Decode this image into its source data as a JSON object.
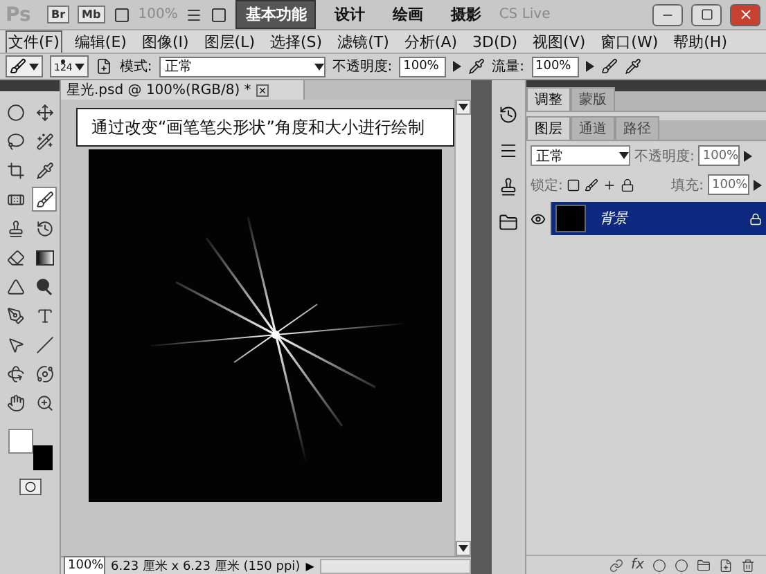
{
  "app_bar": {
    "logo": "Ps",
    "bridge": "Br",
    "mini_bridge": "Mb",
    "zoom": "100%",
    "workspaces": [
      {
        "label": "基本功能",
        "selected": true
      },
      {
        "label": "设计",
        "selected": false
      },
      {
        "label": "绘画",
        "selected": false
      },
      {
        "label": "摄影",
        "selected": false
      }
    ],
    "cs_live": "CS Live"
  },
  "menu": [
    {
      "label": "文件(F)",
      "selected": true
    },
    {
      "label": "编辑(E)",
      "selected": false
    },
    {
      "label": "图像(I)",
      "selected": false
    },
    {
      "label": "图层(L)",
      "selected": false
    },
    {
      "label": "选择(S)",
      "selected": false
    },
    {
      "label": "滤镜(T)",
      "selected": false
    },
    {
      "label": "分析(A)",
      "selected": false
    },
    {
      "label": "3D(D)",
      "selected": false
    },
    {
      "label": "视图(V)",
      "selected": false
    },
    {
      "label": "窗口(W)",
      "selected": false
    },
    {
      "label": "帮助(H)",
      "selected": false
    }
  ],
  "options": {
    "brush_size": "124",
    "mode_label": "模式:",
    "mode": "正常",
    "opacity_label": "不透明度:",
    "opacity": "100%",
    "flow_label": "流量:",
    "flow": "100%"
  },
  "tools": [
    {
      "kind": "marquee",
      "selected": false
    },
    {
      "kind": "move",
      "selected": false
    },
    {
      "kind": "lasso",
      "selected": false
    },
    {
      "kind": "wand",
      "selected": false
    },
    {
      "kind": "crop",
      "selected": false
    },
    {
      "kind": "eyedropper",
      "selected": false
    },
    {
      "kind": "heal",
      "selected": false
    },
    {
      "kind": "brush",
      "selected": true
    },
    {
      "kind": "stamp",
      "selected": false
    },
    {
      "kind": "history",
      "selected": false
    },
    {
      "kind": "eraser",
      "selected": false
    },
    {
      "kind": "gradient",
      "selected": false
    },
    {
      "kind": "blur",
      "selected": false
    },
    {
      "kind": "dodge",
      "selected": false
    },
    {
      "kind": "pen",
      "selected": false
    },
    {
      "kind": "type",
      "selected": false
    },
    {
      "kind": "select",
      "selected": false
    },
    {
      "kind": "line",
      "selected": false
    },
    {
      "kind": "rotate",
      "selected": false
    },
    {
      "kind": "orbit",
      "selected": false
    },
    {
      "kind": "hand",
      "selected": false
    },
    {
      "kind": "zoom",
      "selected": false
    }
  ],
  "document": {
    "tab": "星光.psd @ 100%(RGB/8) *",
    "caption": "通过改变“画笔笔尖形状”角度和大小进行绘制",
    "zoom": "100%",
    "info": "6.23 厘米 x 6.23 厘米 (150 ppi)",
    "info_menu": "▶"
  },
  "panels": {
    "top_tabs": [
      {
        "label": "调整",
        "selected": true
      },
      {
        "label": "蒙版",
        "selected": false
      }
    ],
    "layer_tabs": [
      {
        "label": "图层",
        "selected": true
      },
      {
        "label": "通道",
        "selected": false
      },
      {
        "label": "路径",
        "selected": false
      }
    ],
    "blend_mode": "正常",
    "opacity_label": "不透明度:",
    "opacity": "100%",
    "lock_label": "锁定:",
    "fill_label": "填充:",
    "fill": "100%",
    "layers": [
      {
        "name": "背景",
        "selected": true,
        "visible": true,
        "locked": true
      }
    ],
    "fx": "fx"
  }
}
